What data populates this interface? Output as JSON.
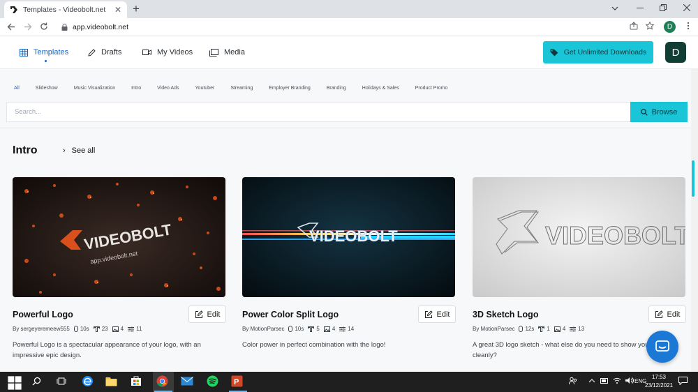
{
  "browser": {
    "tab_title": "Templates - Videobolt.net",
    "tab_close": "✕",
    "new_tab": "+",
    "url": "app.videobolt.net",
    "profile_initial": "D"
  },
  "nav": {
    "items": [
      {
        "label": "Templates",
        "icon": "grid-icon"
      },
      {
        "label": "Drafts",
        "icon": "pencil-icon"
      },
      {
        "label": "My Videos",
        "icon": "video-camera-icon"
      },
      {
        "label": "Media",
        "icon": "media-icon"
      }
    ],
    "cta_label": "Get Unlimited Downloads",
    "user_initial": "D"
  },
  "categories": [
    "All",
    "Slideshow",
    "Music Visualization",
    "Intro",
    "Video Ads",
    "Youtuber",
    "Streaming",
    "Employer Branding",
    "Branding",
    "Holidays & Sales",
    "Product Promo"
  ],
  "search": {
    "placeholder": "Search...",
    "button_label": "Browse"
  },
  "section": {
    "title": "Intro",
    "see_all": "See all"
  },
  "cards": [
    {
      "title": "Powerful Logo",
      "edit_label": "Edit",
      "author": "By sergeyeremeew555",
      "duration": "10s",
      "texts": "23",
      "images": "4",
      "adjustments": "11",
      "description": "Powerful Logo is a spectacular appearance of your logo, with an impressive epic design.",
      "thumb_text": "VIDEOBOLT",
      "thumb_subtext": "app.videobolt.net"
    },
    {
      "title": "Power Color Split Logo",
      "edit_label": "Edit",
      "author": "By MotionParsec",
      "duration": "10s",
      "texts": "5",
      "images": "4",
      "adjustments": "14",
      "description": "Color power in perfect combination with the logo!",
      "thumb_text": "VIDEOBOLT"
    },
    {
      "title": "3D Sketch Logo",
      "edit_label": "Edit",
      "author": "By MotionParsec",
      "duration": "12s",
      "texts": "1",
      "images": "4",
      "adjustments": "13",
      "description": "A great 3D logo sketch - what else do you need to show your brand cleanly?",
      "thumb_text": "VIDEOBOLT"
    }
  ],
  "taskbar": {
    "time": "17:53",
    "date": "23/12/2021"
  },
  "colors": {
    "accent": "#19c5d6",
    "active_nav": "#1565c0",
    "user_avatar": "#103e34",
    "chat": "#1c78d5"
  }
}
